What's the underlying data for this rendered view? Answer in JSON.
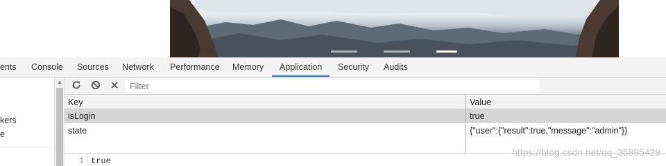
{
  "devtools": {
    "tabs": [
      "ents",
      "Console",
      "Sources",
      "Network",
      "Performance",
      "Memory",
      "Application",
      "Security",
      "Audits"
    ],
    "active_tab": "Application",
    "accent_color": "#1a73e8"
  },
  "sidebar": {
    "items": [
      "kers",
      "e"
    ]
  },
  "toolbar": {
    "refresh_icon": "refresh-icon",
    "clear_icon": "clear-all-icon",
    "delete_icon": "delete-icon",
    "filter_placeholder": "Filter"
  },
  "storage_table": {
    "columns": [
      "Key",
      "Value"
    ],
    "rows": [
      {
        "key": "isLogin",
        "value": "true",
        "selected": true
      },
      {
        "key": "state",
        "value": "{\"user\":{\"result\":true,\"message\":\"admin\"}}",
        "selected": false
      }
    ]
  },
  "preview": {
    "line_number": "1",
    "text": "true"
  },
  "watermark": "https://blog.csdn.net/qq_35885429"
}
